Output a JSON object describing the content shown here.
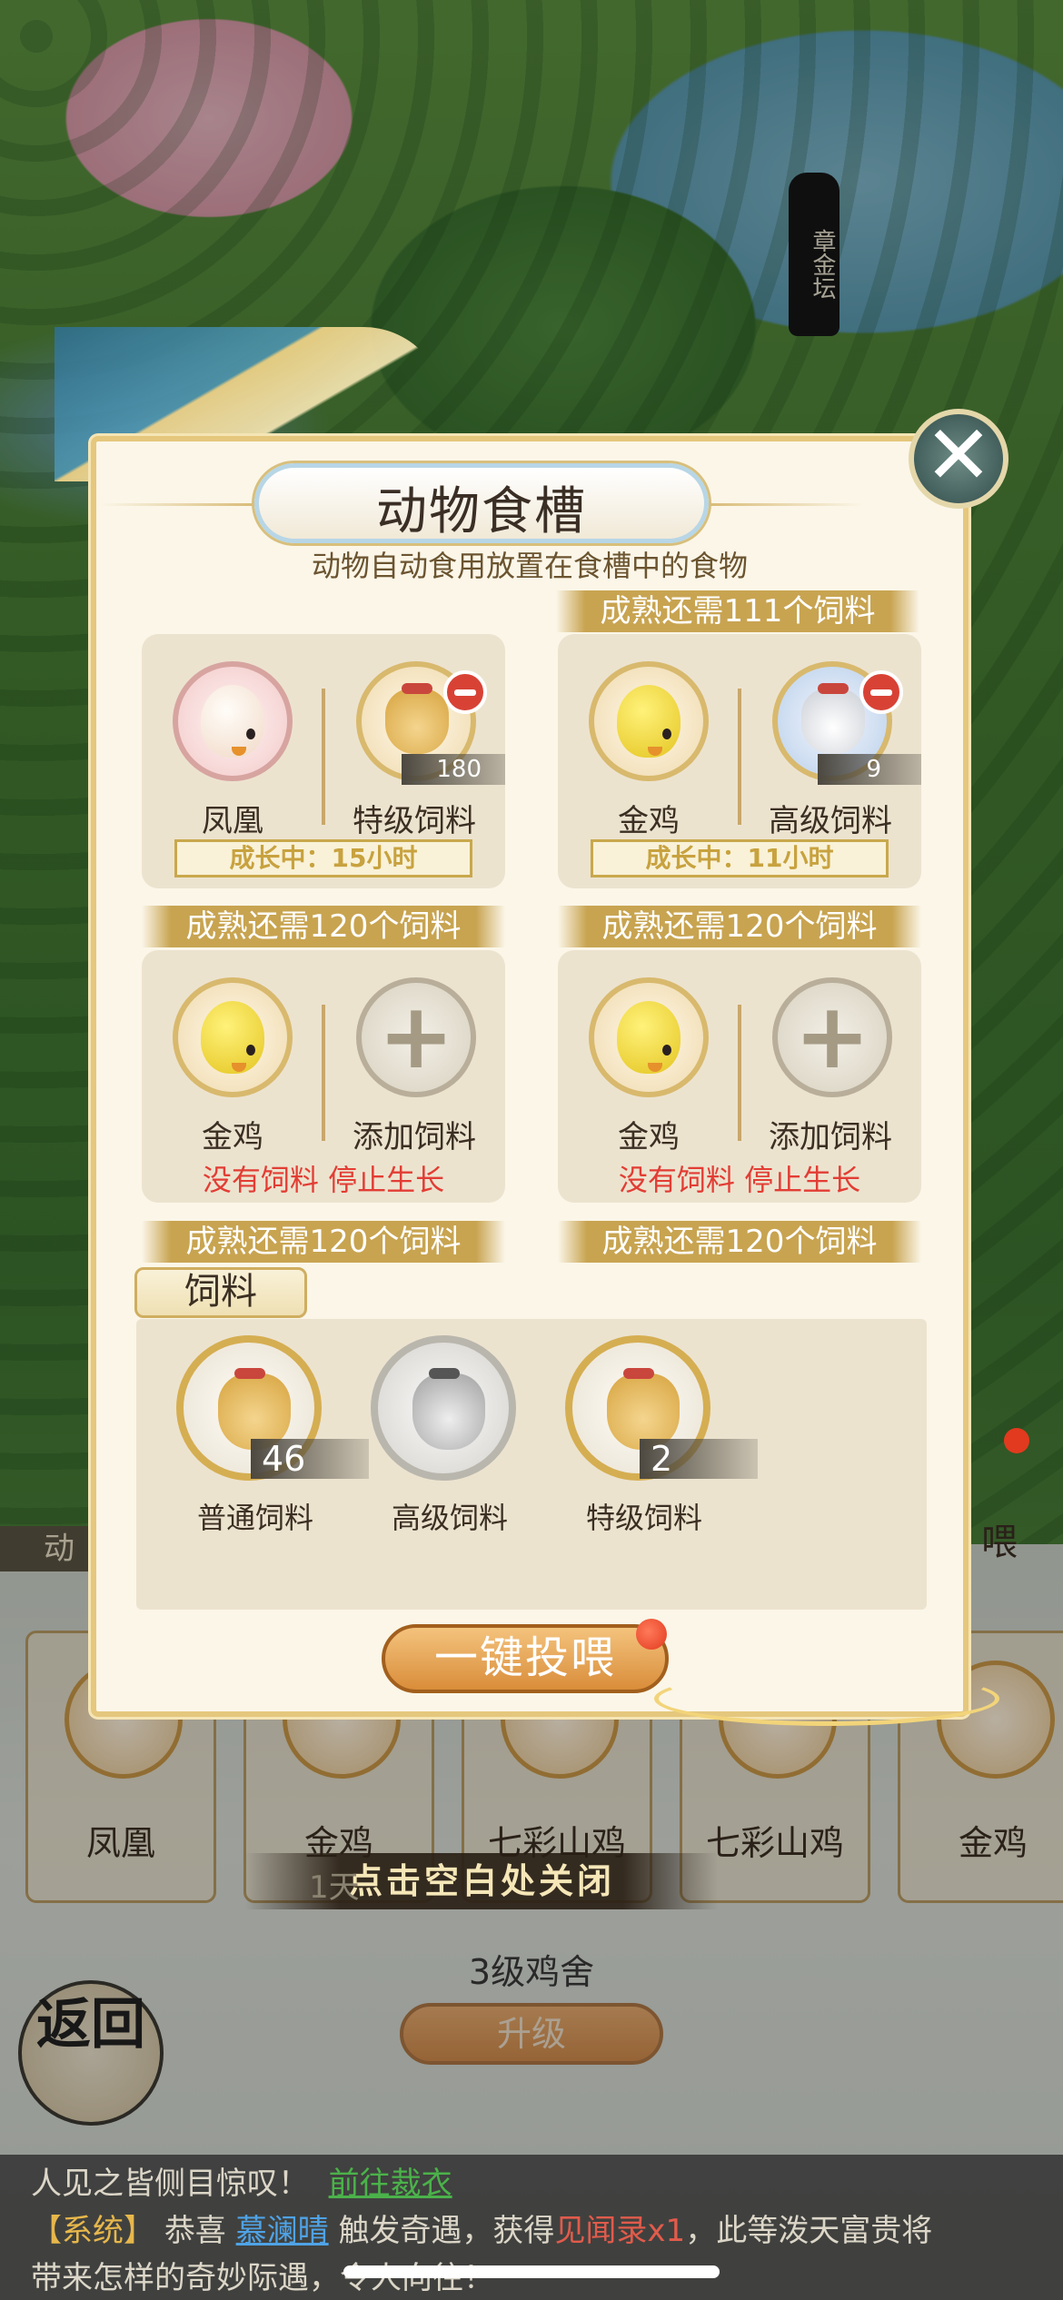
{
  "background": {
    "stele_text": "章金坛"
  },
  "modal": {
    "title": "动物食槽",
    "subtitle": "动物自动食用放置在食槽中的食物",
    "close_symbol": "✕",
    "troughs": [
      {
        "top_banner": "",
        "animal": "凤凰",
        "feed": "特级饲料",
        "feed_qty": "180",
        "status": "成长中：15小时",
        "bottom_banner": "成熟还需120个饲料"
      },
      {
        "top_banner": "成熟还需111个饲料",
        "animal": "金鸡",
        "feed": "高级饲料",
        "feed_qty": "9",
        "status": "成长中：11小时",
        "bottom_banner": "成熟还需120个饲料"
      },
      {
        "animal": "金鸡",
        "feed": "添加饲料",
        "warning": "没有饲料 停止生长",
        "bottom_banner": "成熟还需120个饲料"
      },
      {
        "animal": "金鸡",
        "feed": "添加饲料",
        "warning": "没有饲料 停止生长",
        "bottom_banner": "成熟还需120个饲料"
      }
    ],
    "feed_section": {
      "tab_label": "饲料",
      "items": [
        {
          "label": "普通饲料",
          "count": "46"
        },
        {
          "label": "高级饲料",
          "count": ""
        },
        {
          "label": "特级饲料",
          "count": "2"
        }
      ]
    },
    "feed_all_button": "一键投喂"
  },
  "underlay": {
    "side_tab": "动",
    "right_label": "喂",
    "slots": [
      "凤凰",
      "金鸡",
      "七彩山鸡",
      "七彩山鸡",
      "金鸡"
    ],
    "day_text": "1天",
    "close_hint": "点击空白处关闭",
    "coop_level": "3级鸡舍",
    "upgrade_button": "升级",
    "back_button": "返回"
  },
  "chat": {
    "line1_text": "人见之皆侧目惊叹！",
    "line1_link": "前往裁衣",
    "sys_tag": "【系统】",
    "msg_a": "恭喜",
    "player": "慕澜晴",
    "msg_b": "触发奇遇，获得",
    "item": "见闻录x1",
    "msg_c": "，此等泼天富贵将",
    "line3": "带来怎样的奇妙际遇，令人向往！"
  },
  "colors": {
    "accent_gold": "#c8a451",
    "warning_red": "#e23d34",
    "chat_link_green": "#4bb24a"
  }
}
